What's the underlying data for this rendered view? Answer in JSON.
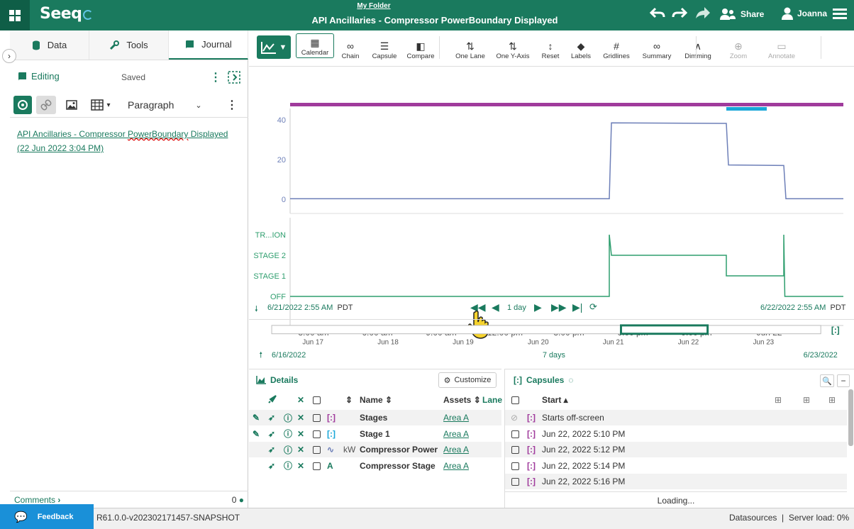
{
  "topbar": {
    "folder": "My Folder",
    "title": "API Ancillaries - Compressor PowerBoundary Displayed",
    "share_label": "Share",
    "user_name": "Joanna",
    "brand": "Seeq"
  },
  "left_tabs": [
    {
      "label": "Data",
      "icon": "database-icon"
    },
    {
      "label": "Tools",
      "icon": "wrench-icon"
    },
    {
      "label": "Journal",
      "icon": "book-icon"
    }
  ],
  "journal": {
    "mode": "Editing",
    "status": "Saved",
    "paragraph_select": "Paragraph",
    "entry_line1_a": "API Ancillaries - Compressor ",
    "entry_line1_b": "PowerBoundary",
    "entry_line1_c": " Displayed",
    "entry_line2": "(22 Jun 2022 3:04 PM)"
  },
  "comments": {
    "label": "Comments",
    "count": "0"
  },
  "toolbar": {
    "tools": [
      {
        "label": "Calendar",
        "icon": "calendar-icon"
      },
      {
        "label": "Chain",
        "icon": "chain-icon"
      },
      {
        "label": "Capsule",
        "icon": "capsule-icon"
      },
      {
        "label": "Compare",
        "icon": "compare-icon"
      },
      {
        "label": "One Lane",
        "icon": "one-lane-icon"
      },
      {
        "label": "One Y-Axis",
        "icon": "one-y-axis-icon"
      },
      {
        "label": "Reset",
        "icon": "reset-icon"
      },
      {
        "label": "Labels",
        "icon": "tag-icon"
      },
      {
        "label": "Gridlines",
        "icon": "grid-icon"
      },
      {
        "label": "Summary",
        "icon": "summary-icon"
      },
      {
        "label": "Dimming",
        "icon": "dimming-icon"
      },
      {
        "label": "Zoom",
        "icon": "zoom-icon"
      },
      {
        "label": "Annotate",
        "icon": "annotate-icon"
      }
    ]
  },
  "chart_data": {
    "type": "line",
    "x_tick_labels": [
      "3:00 am",
      "6:00 am",
      "9:00 am",
      "12:00 pm",
      "3:00 pm",
      "6:00 pm",
      "9:00 pm",
      "Jun 22"
    ],
    "lanes": [
      {
        "name": "Compressor Power",
        "unit": "kW",
        "y_ticks": [
          0,
          20,
          40
        ],
        "color": "#6d7fb8",
        "points": [
          [
            0,
            0.3
          ],
          [
            15.0,
            0.3
          ],
          [
            15.1,
            38.5
          ],
          [
            20.5,
            38.2
          ],
          [
            20.6,
            17.3
          ],
          [
            23.2,
            17.0
          ],
          [
            23.3,
            0.3
          ],
          [
            26.0,
            0.3
          ]
        ]
      },
      {
        "name": "Compressor Stage",
        "y_categories": [
          "OFF",
          "STAGE 1",
          "STAGE 2",
          "TR...ION"
        ],
        "color": "#2e9e6e",
        "points": [
          [
            0,
            "OFF"
          ],
          [
            15.0,
            "OFF"
          ],
          [
            15.0,
            "TR...ION"
          ],
          [
            15.1,
            "STAGE 2"
          ],
          [
            20.5,
            "STAGE 2"
          ],
          [
            20.5,
            "STAGE 1"
          ],
          [
            23.2,
            "STAGE 1"
          ],
          [
            23.2,
            "TR...ION"
          ],
          [
            23.25,
            "OFF"
          ],
          [
            26.0,
            "OFF"
          ]
        ]
      }
    ],
    "capsule_bars": [
      {
        "name": "Stages",
        "color": "#a03b9c"
      },
      {
        "name": "Stage 1",
        "color": "#1aa7d8"
      }
    ]
  },
  "range": {
    "start": "6/21/2022 2:55 AM",
    "end": "6/22/2022 2:55 AM",
    "tz": "PDT",
    "duration": "1 day"
  },
  "overview": {
    "ticks": [
      "Jun 17",
      "Jun 18",
      "Jun 19",
      "Jun 20",
      "Jun 21",
      "Jun 22",
      "Jun 23"
    ],
    "start": "6/16/2022",
    "end": "6/23/2022",
    "duration": "7 days"
  },
  "details": {
    "title": "Details",
    "customize": "Customize",
    "headers": {
      "name": "Name",
      "assets": "Assets",
      "lane": "Lane"
    },
    "rows": [
      {
        "unit": "",
        "name": "Stages",
        "asset": "Area A",
        "color": "#a03b9c"
      },
      {
        "unit": "",
        "name": "Stage 1",
        "asset": "Area A",
        "color": "#1aa7d8"
      },
      {
        "unit": "kW",
        "name": "Compressor Power",
        "asset": "Area A",
        "color": "#6d7fb8"
      },
      {
        "unit": "",
        "name": "Compressor Stage",
        "asset": "Area A",
        "color": "#1a7a5e"
      }
    ]
  },
  "capsules": {
    "title": "Capsules",
    "start_header": "Start",
    "rows": [
      "Starts off-screen",
      "Jun 22, 2022 5:10 PM",
      "Jun 22, 2022 5:12 PM",
      "Jun 22, 2022 5:14 PM",
      "Jun 22, 2022 5:16 PM"
    ],
    "loading": "Loading..."
  },
  "footer": {
    "feedback": "Feedback",
    "version": "R61.0.0-v202302171457-SNAPSHOT",
    "datasources": "Datasources",
    "server_load": "Server load:",
    "server_load_value": "0%"
  }
}
